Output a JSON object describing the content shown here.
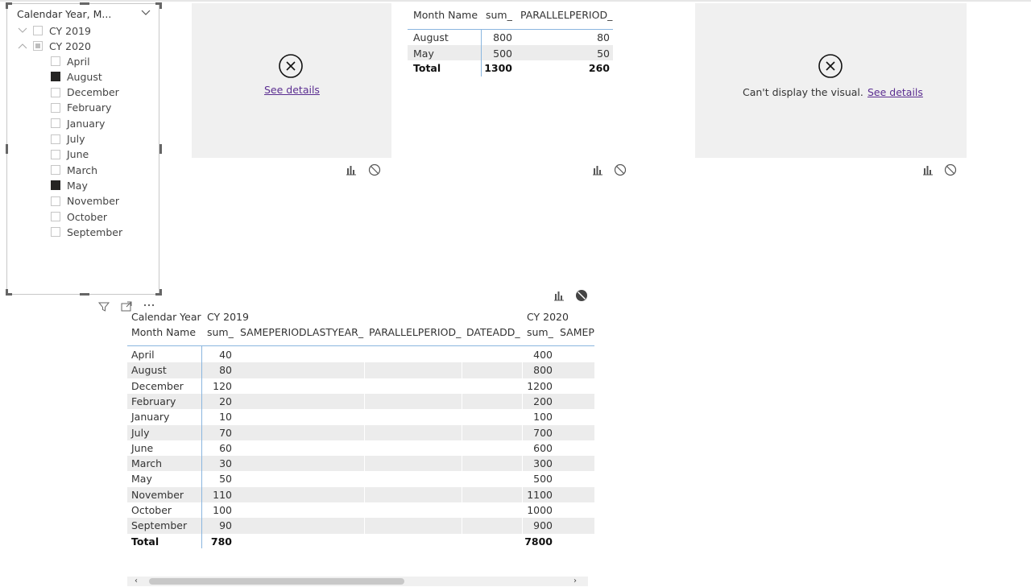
{
  "slicer": {
    "title": "Calendar Year, M...",
    "years": [
      {
        "label": "CY 2019",
        "state": "collapsed"
      },
      {
        "label": "CY 2020",
        "state": "expanded"
      }
    ],
    "months": [
      {
        "label": "April",
        "checked": false
      },
      {
        "label": "August",
        "checked": true
      },
      {
        "label": "December",
        "checked": false
      },
      {
        "label": "February",
        "checked": false
      },
      {
        "label": "January",
        "checked": false
      },
      {
        "label": "July",
        "checked": false
      },
      {
        "label": "June",
        "checked": false
      },
      {
        "label": "March",
        "checked": false
      },
      {
        "label": "May",
        "checked": true
      },
      {
        "label": "November",
        "checked": false
      },
      {
        "label": "October",
        "checked": false
      },
      {
        "label": "September",
        "checked": false
      }
    ]
  },
  "visual_left": {
    "link": "See details"
  },
  "visual_right": {
    "message": "Can't display the visual.",
    "link": "See details"
  },
  "small_table": {
    "headers": [
      "Month Name",
      "sum_",
      "PARALLELPERIOD_"
    ],
    "rows": [
      [
        "August",
        "800",
        "80"
      ],
      [
        "May",
        "500",
        "50"
      ]
    ],
    "total": [
      "Total",
      "1300",
      "260"
    ]
  },
  "matrix": {
    "row_header_1": "Calendar Year",
    "row_header_2": "Month Name",
    "group_2019": "CY 2019",
    "group_2020": "CY 2020",
    "columns": [
      "sum_",
      "SAMEPERIODLASTYEAR_",
      "PARALLELPERIOD_",
      "DATEADD_",
      "sum_",
      "SAMEP"
    ],
    "rows": [
      [
        "April",
        "40",
        "400"
      ],
      [
        "August",
        "80",
        "800"
      ],
      [
        "December",
        "120",
        "1200"
      ],
      [
        "February",
        "20",
        "200"
      ],
      [
        "January",
        "10",
        "100"
      ],
      [
        "July",
        "70",
        "700"
      ],
      [
        "June",
        "60",
        "600"
      ],
      [
        "March",
        "30",
        "300"
      ],
      [
        "May",
        "50",
        "500"
      ],
      [
        "November",
        "110",
        "1100"
      ],
      [
        "October",
        "100",
        "1000"
      ],
      [
        "September",
        "90",
        "900"
      ]
    ],
    "total": [
      "Total",
      "780",
      "7800"
    ]
  },
  "scrollbar": {
    "left": "‹",
    "right": "›"
  }
}
